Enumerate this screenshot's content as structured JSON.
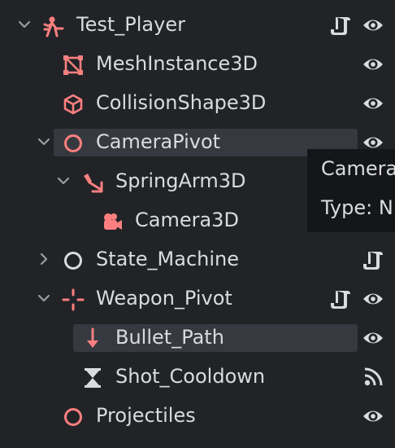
{
  "colors": {
    "background": "#212327",
    "node_icon_red": "#fc7f7f",
    "text": "#dadbdd",
    "highlight": "#363a40",
    "tooltip_bg": "#151619"
  },
  "tree": {
    "nodes": [
      {
        "name": "Test_Player",
        "icon": "character-body-3d-icon",
        "arrow": "expanded",
        "right_icons": [
          "script-icon",
          "visibility-eye-icon"
        ]
      },
      {
        "name": "MeshInstance3D",
        "icon": "mesh-instance-3d-icon",
        "arrow": "none",
        "right_icons": [
          "visibility-eye-icon"
        ]
      },
      {
        "name": "CollisionShape3D",
        "icon": "collision-shape-3d-icon",
        "arrow": "none",
        "right_icons": [
          "visibility-eye-icon"
        ]
      },
      {
        "name": "CameraPivot",
        "icon": "node-3d-icon",
        "arrow": "expanded",
        "right_icons": [
          "visibility-eye-icon"
        ],
        "hovered": true
      },
      {
        "name": "SpringArm3D",
        "icon": "spring-arm-3d-icon",
        "arrow": "expanded",
        "right_icons": [
          "visibility-eye-icon"
        ]
      },
      {
        "name": "Camera3D",
        "icon": "camera-3d-icon",
        "arrow": "none",
        "right_icons": [
          "visibility-eye-icon"
        ]
      },
      {
        "name": "State_Machine",
        "icon": "node-icon",
        "arrow": "collapsed",
        "right_icons": [
          "script-icon"
        ]
      },
      {
        "name": "Weapon_Pivot",
        "icon": "marker-3d-icon",
        "arrow": "expanded",
        "right_icons": [
          "script-icon",
          "visibility-eye-icon"
        ]
      },
      {
        "name": "Bullet_Path",
        "icon": "ray-cast-3d-icon",
        "arrow": "none",
        "right_icons": [
          "visibility-eye-icon"
        ],
        "selected": true
      },
      {
        "name": "Shot_Cooldown",
        "icon": "timer-icon",
        "arrow": "none",
        "right_icons": [
          "signals-icon"
        ]
      },
      {
        "name": "Projectiles",
        "icon": "node-3d-icon",
        "arrow": "none",
        "right_icons": [
          "visibility-eye-icon"
        ]
      }
    ]
  },
  "tooltip": {
    "line1": "Camera",
    "line2": "Type: N"
  }
}
